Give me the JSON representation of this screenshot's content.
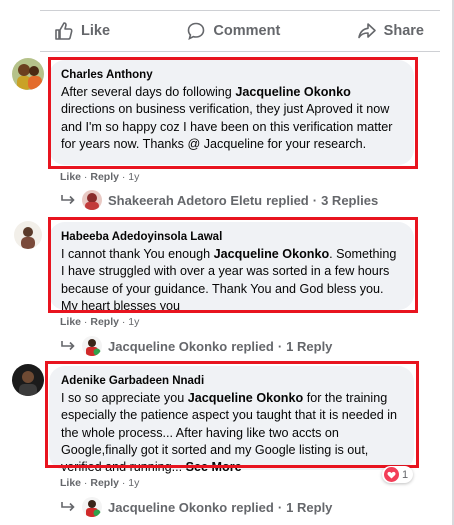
{
  "actions": {
    "like": "Like",
    "comment": "Comment",
    "share": "Share"
  },
  "comments": [
    {
      "author": "Charles Anthony",
      "text_pre": "After several days do following ",
      "mention": "Jacqueline Okonko",
      "text_post": " directions on business verification, they just Aproved it now and I'm so happy coz I have been on this verification matter for years now. Thanks @ Jacqueline for your research.",
      "meta": {
        "like": "Like",
        "reply": "Reply",
        "sep": " · ",
        "time": "1y"
      },
      "replies": {
        "name": "Shakeerah Adetoro Eletu",
        "label": "replied",
        "count": "3 Replies"
      }
    },
    {
      "author": "Habeeba Adedoyinsola Lawal",
      "text_pre": "I cannot thank You enough ",
      "mention": "Jacqueline Okonko",
      "text_post": ". Something I have struggled with over a year was sorted in a few hours because of your guidance. Thank You and God bless you. My heart blesses you",
      "meta": {
        "like": "Like",
        "reply": "Reply",
        "sep": " · ",
        "time": "1y"
      },
      "replies": {
        "name": "Jacqueline Okonko",
        "label": "replied",
        "count": "1 Reply"
      }
    },
    {
      "author": "Adenike Garbadeen Nnadi",
      "text_pre": "I so so appreciate you ",
      "mention": "Jacqueline Okonko",
      "text_post": " for the training especially the patience aspect you taught that it is needed in the whole process... After having like two accts on Google,finally got it sorted and my Google listing is out, verified and running... ",
      "see_more": "See More",
      "meta": {
        "like": "Like",
        "reply": "Reply",
        "sep": " · ",
        "time": "1y"
      },
      "reactions": {
        "icon": "heart-icon",
        "count": "1"
      },
      "replies": {
        "name": "Jacqueline Okonko",
        "label": "replied",
        "count": "1 Reply"
      }
    }
  ],
  "colors": {
    "highlight": "#e8141f",
    "bubble": "#f0f2f5",
    "muted": "#65676b"
  }
}
